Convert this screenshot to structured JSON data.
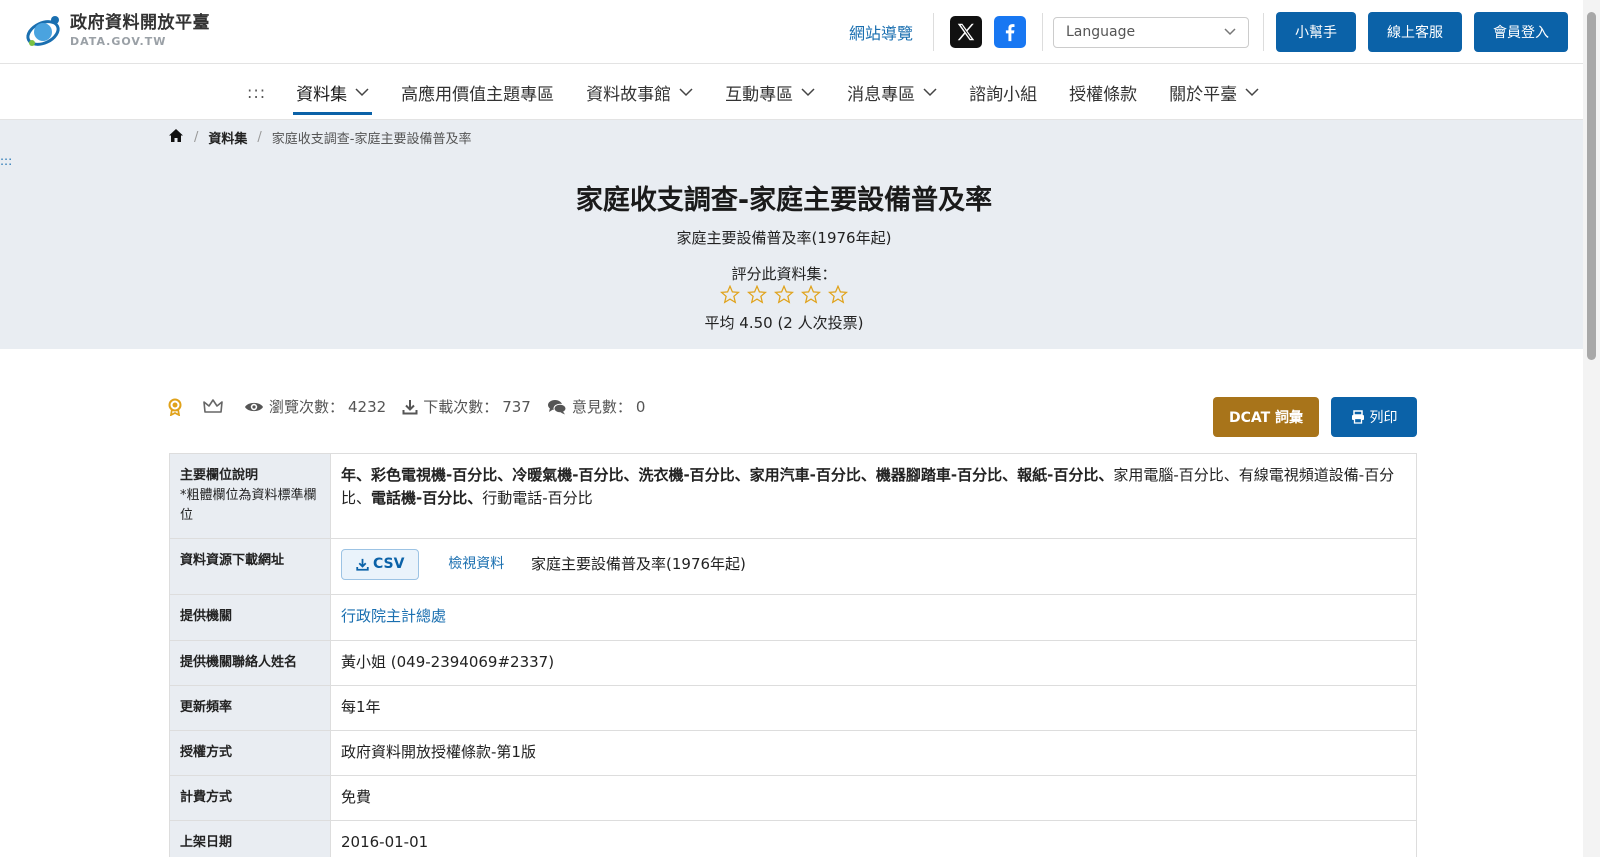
{
  "header": {
    "logo_title": "政府資料開放平臺",
    "logo_sub": "DATA.GOV.TW",
    "site_map": "網站導覽",
    "language_placeholder": "Language",
    "buttons": {
      "helper": "小幫手",
      "support": "線上客服",
      "login": "會員登入"
    }
  },
  "nav": {
    "dots": ":::",
    "items": [
      {
        "label": "資料集",
        "dropdown": true,
        "active": true
      },
      {
        "label": "高應用價值主題專區"
      },
      {
        "label": "資料故事館",
        "dropdown": true
      },
      {
        "label": "互動專區",
        "dropdown": true
      },
      {
        "label": "消息專區",
        "dropdown": true
      },
      {
        "label": "諮詢小組"
      },
      {
        "label": "授權條款"
      },
      {
        "label": "關於平臺",
        "dropdown": true
      }
    ]
  },
  "breadcrumb": {
    "sep": "/",
    "dataset": "資料集",
    "current": "家庭收支調查-家庭主要設備普及率"
  },
  "side_dots": ":::",
  "hero": {
    "title": "家庭收支調查-家庭主要設備普及率",
    "subtitle": "家庭主要設備普及率(1976年起)",
    "rate_label": "評分此資料集：",
    "stars_total": 5,
    "avg_text": "平均 4.50 (2 人次投票)"
  },
  "stats": {
    "views_label": "瀏覽次數：",
    "views": "4232",
    "downloads_label": "下載次數：",
    "downloads": "737",
    "comments_label": "意見數：",
    "comments": "0"
  },
  "actions": {
    "dcat": "DCAT 詞彙",
    "print": "列印"
  },
  "table": {
    "fields_key": "主要欄位說明",
    "fields_note": "*粗體欄位為資料標準欄位",
    "fields_bold": "年、彩色電視機-百分比、冷暖氣機-百分比、洗衣機-百分比、家用汽車-百分比、機器腳踏車-百分比、報紙-百分比、",
    "fields_normal": "家用電腦-百分比、有線電視頻道設備-百分比、",
    "fields_bold2": "電話機-百分比、",
    "fields_normal2": "行動電話-百分比",
    "download_key": "資料資源下載網址",
    "csv_label": "CSV",
    "view_label": "檢視資料",
    "resource_name": "家庭主要設備普及率(1976年起)",
    "provider_key": "提供機關",
    "provider": "行政院主計總處",
    "contact_key": "提供機關聯絡人姓名",
    "contact": "黃小姐 (049-2394069#2337)",
    "frequency_key": "更新頻率",
    "frequency": "每1年",
    "license_key": "授權方式",
    "license": "政府資料開放授權條款-第1版",
    "fee_key": "計費方式",
    "fee": "免費",
    "date_key": "上架日期",
    "date": "2016-01-01"
  },
  "colors": {
    "primary": "#0b62a8",
    "dcat": "#a8741a",
    "hero_bg": "#e9edf2",
    "star": "#e0a21a"
  }
}
